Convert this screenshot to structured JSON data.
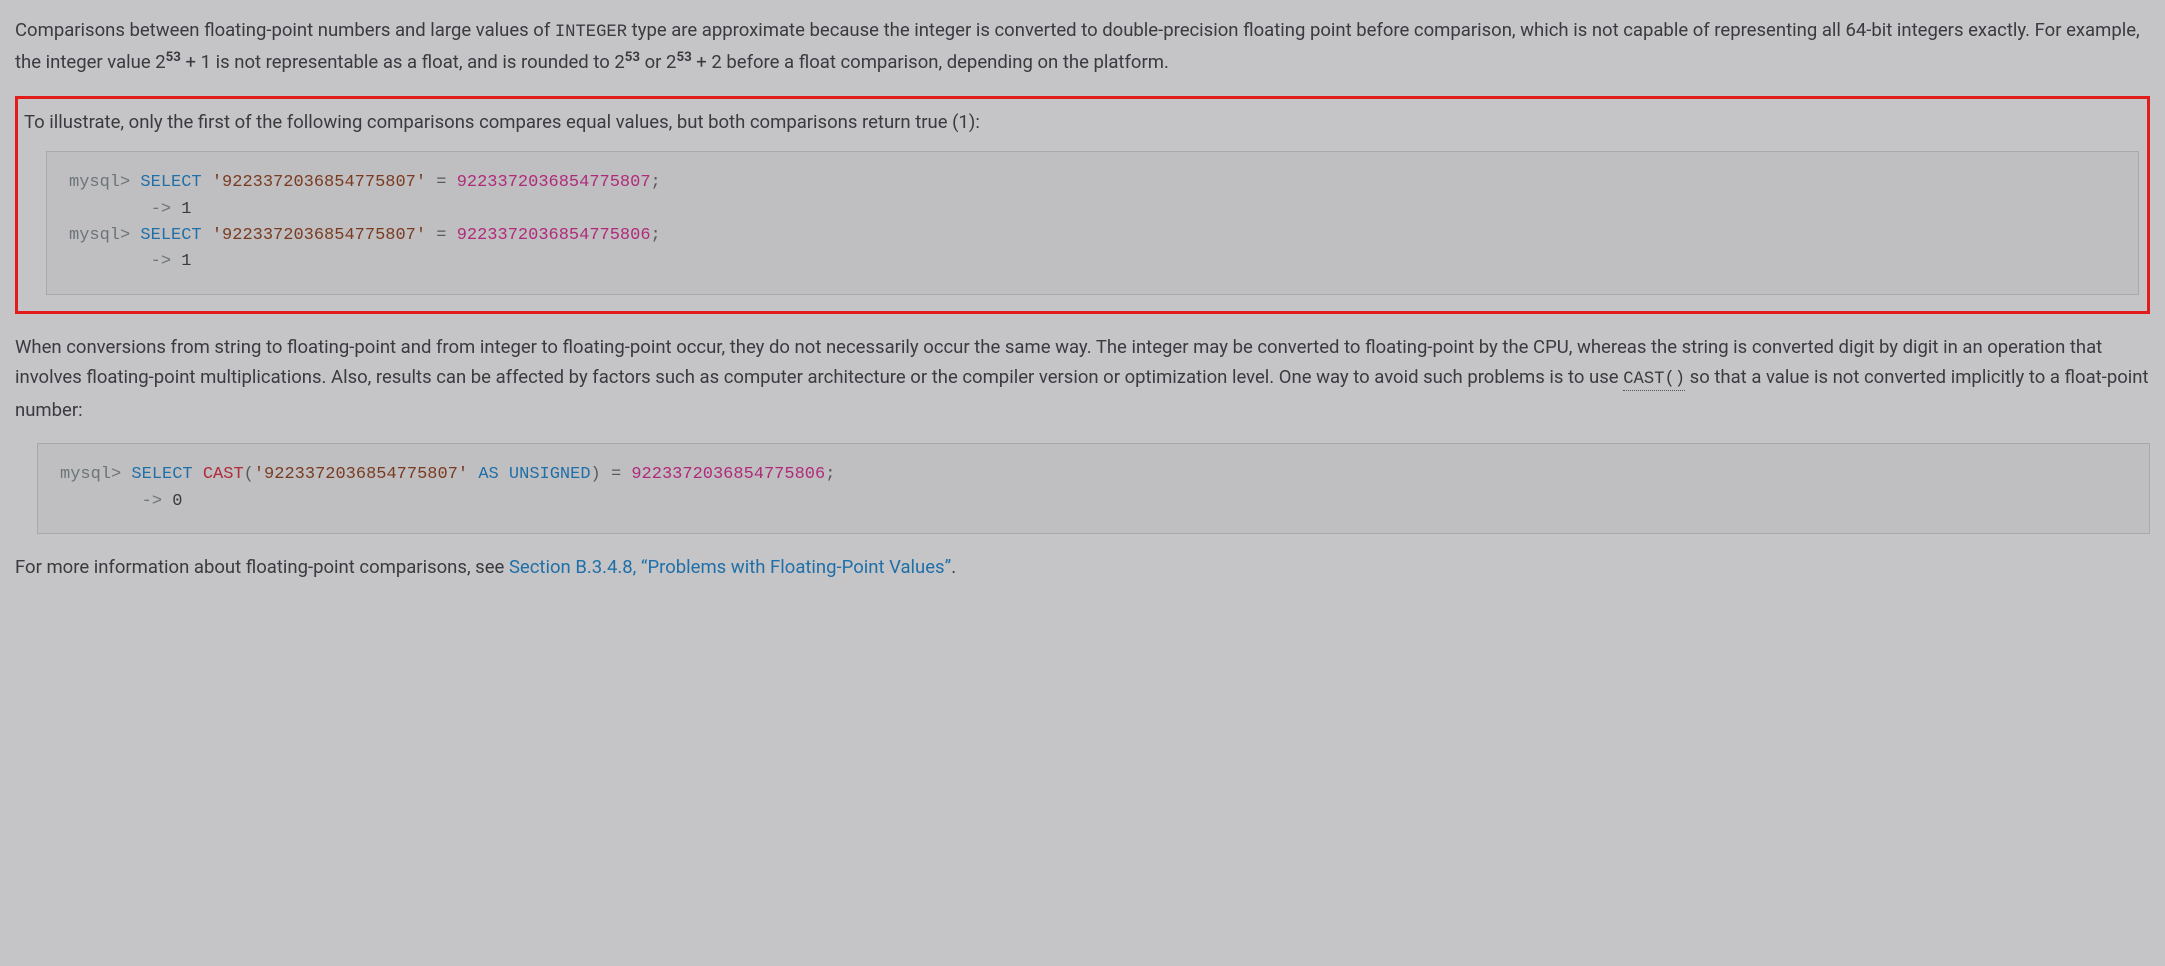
{
  "para1": {
    "t1": "Comparisons between floating-point numbers and large values of ",
    "code1": "INTEGER",
    "t2": " type are approximate because the integer is converted to double-precision floating point before comparison, which is not capable of representing all 64-bit integers exactly. For example, the integer value 2",
    "sup1": "53",
    "t3": " + 1 is not representable as a float, and is rounded to 2",
    "sup2": "53",
    "t4": " or 2",
    "sup3": "53",
    "t5": " + 2 before a float comparison, depending on the platform."
  },
  "highlighted": {
    "intro": "To illustrate, only the first of the following comparisons compares equal values, but both comparisons return true (1):",
    "code": {
      "l1_prompt": "mysql> ",
      "l1_select": "SELECT",
      "l1_sp1": " ",
      "l1_str": "'9223372036854775807'",
      "l1_sp2": " ",
      "l1_eq": "=",
      "l1_sp3": " ",
      "l1_num": "9223372036854775807",
      "l1_semi": ";",
      "l2_pad": "        ",
      "l2_arrow": "->",
      "l2_sp": " ",
      "l2_res": "1",
      "l3_prompt": "mysql> ",
      "l3_select": "SELECT",
      "l3_sp1": " ",
      "l3_str": "'9223372036854775807'",
      "l3_sp2": " ",
      "l3_eq": "=",
      "l3_sp3": " ",
      "l3_num": "9223372036854775806",
      "l3_semi": ";",
      "l4_pad": "        ",
      "l4_arrow": "->",
      "l4_sp": " ",
      "l4_res": "1"
    }
  },
  "para2": {
    "t1": "When conversions from string to floating-point and from integer to floating-point occur, they do not necessarily occur the same way. The integer may be converted to floating-point by the CPU, whereas the string is converted digit by digit in an operation that involves floating-point multiplications. Also, results can be affected by factors such as computer architecture or the compiler version or optimization level. One way to avoid such problems is to use ",
    "code1": "CAST()",
    "t2": " so that a value is not converted implicitly to a float-point number:"
  },
  "castcode": {
    "l1_prompt": "mysql> ",
    "l1_select": "SELECT",
    "l1_sp1": " ",
    "l1_cast": "CAST",
    "l1_op": "(",
    "l1_str": "'9223372036854775807'",
    "l1_sp2": " ",
    "l1_as": "AS",
    "l1_sp3": " ",
    "l1_unsigned": "UNSIGNED",
    "l1_cp": ")",
    "l1_sp4": " ",
    "l1_eq": "=",
    "l1_sp5": " ",
    "l1_num": "9223372036854775806",
    "l1_semi": ";",
    "l2_pad": "        ",
    "l2_arrow": "->",
    "l2_sp": " ",
    "l2_res": "0"
  },
  "para3": {
    "t1": "For more information about floating-point comparisons, see ",
    "link": "Section B.3.4.8, “Problems with Floating-Point Values”",
    "t2": "."
  }
}
